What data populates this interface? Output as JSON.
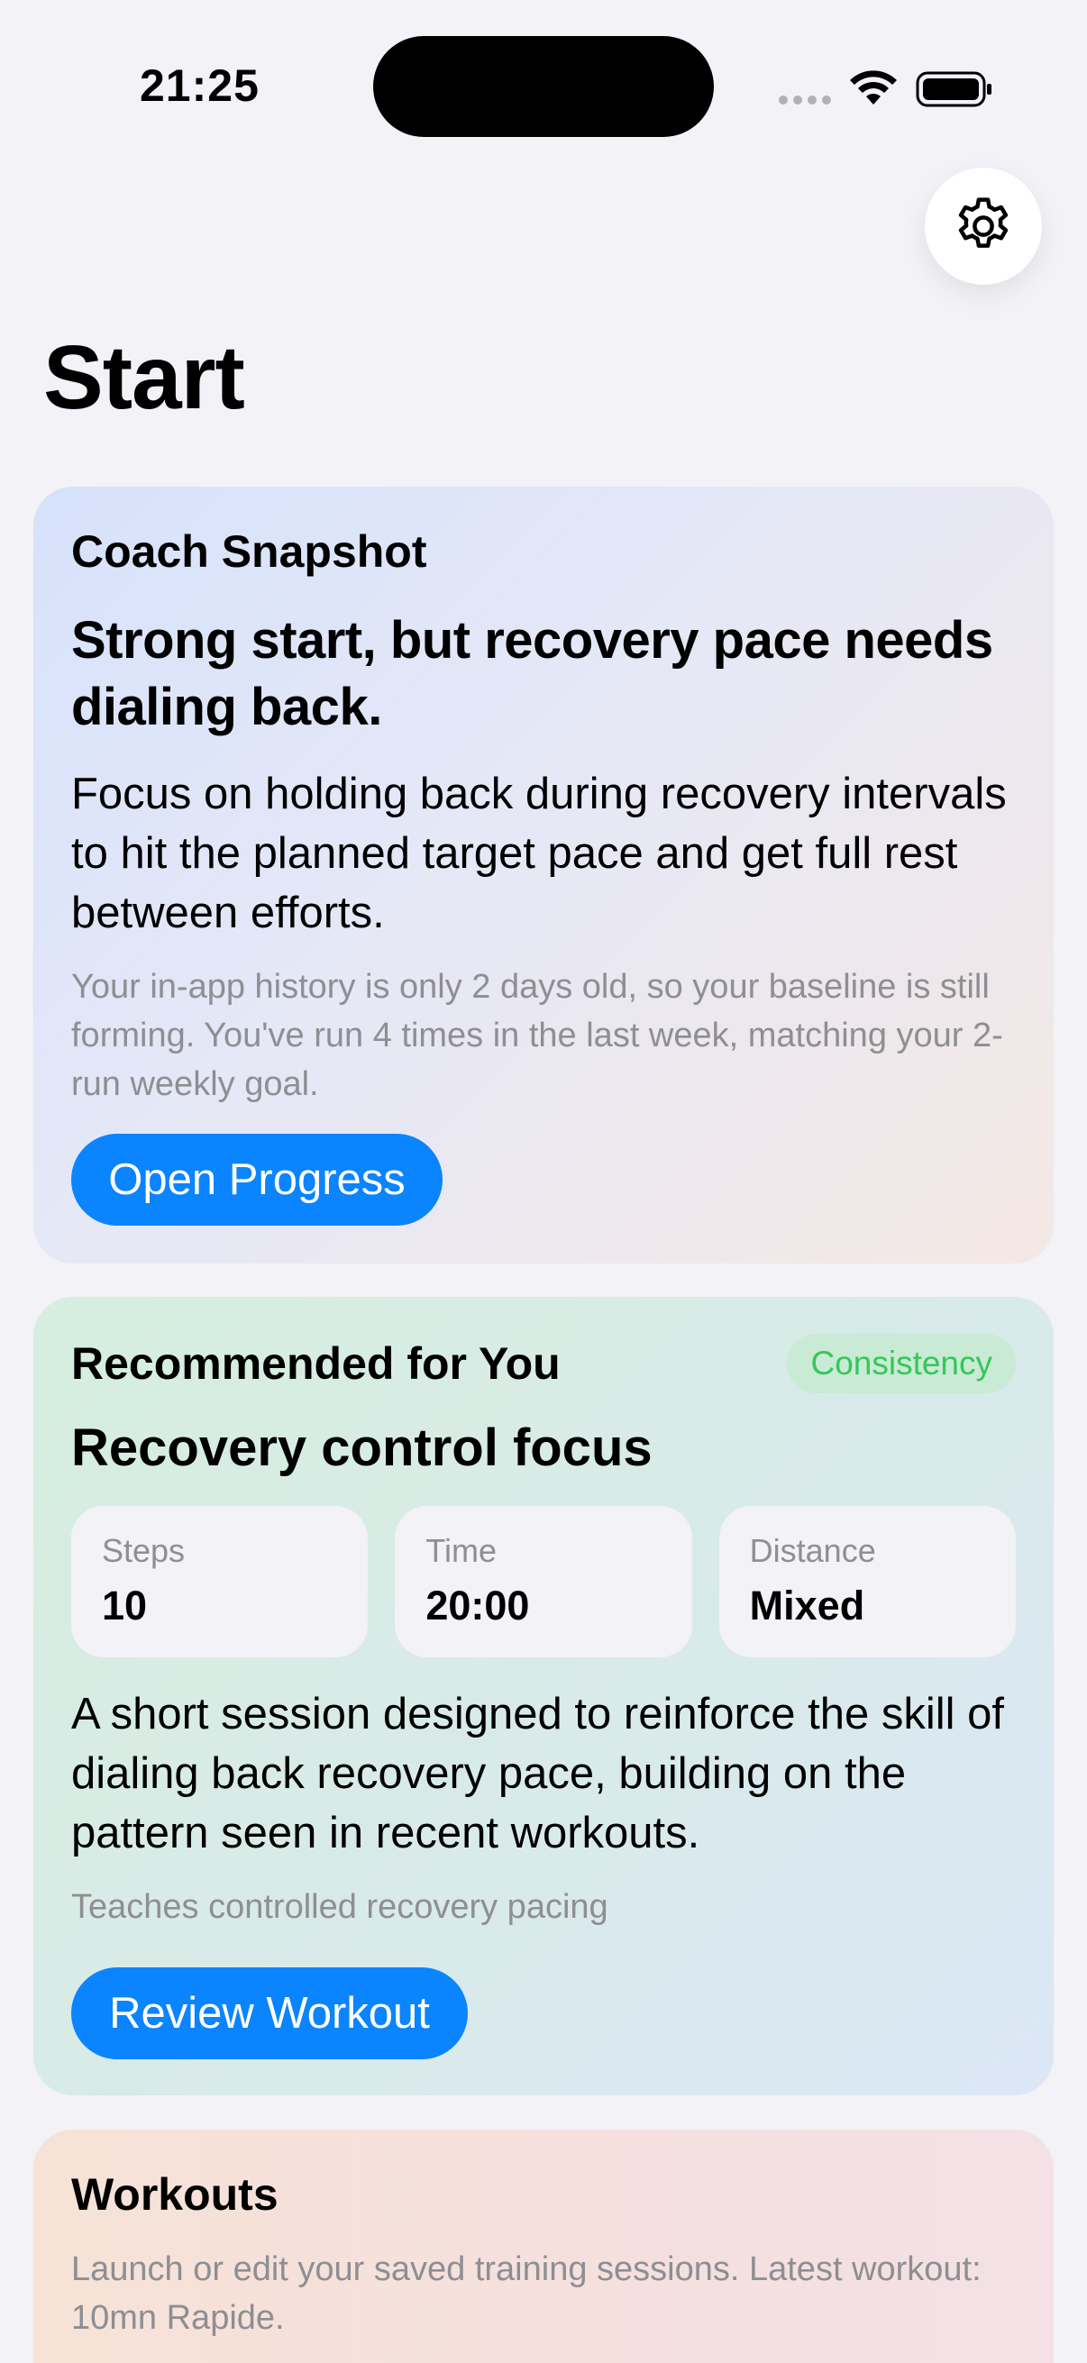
{
  "status_bar": {
    "time": "21:25"
  },
  "icons": {
    "settings": "gear-icon",
    "wifi": "wifi-icon",
    "battery": "battery-icon",
    "signal": "cellular-signal-icon"
  },
  "colors": {
    "accent": "#0a84ff",
    "badge_text": "#34c759",
    "background": "#f2f2f7"
  },
  "page": {
    "title": "Start"
  },
  "coach_card": {
    "heading": "Coach Snapshot",
    "headline": "Strong start, but recovery pace needs dialing back.",
    "body": "Focus on holding back during recovery intervals to hit the planned target pace and get full rest between efforts.",
    "note": "Your in-app history is only 2 days old, so your baseline is still forming. You've run 4 times in the last week, matching your 2-run weekly goal.",
    "button_label": "Open Progress"
  },
  "recommended_card": {
    "heading": "Recommended for You",
    "badge": "Consistency",
    "title": "Recovery control focus",
    "metrics": [
      {
        "label": "Steps",
        "value": "10"
      },
      {
        "label": "Time",
        "value": "20:00"
      },
      {
        "label": "Distance",
        "value": "Mixed"
      }
    ],
    "body": "A short session designed to reinforce the skill of dialing back recovery pace, building on the pattern seen in recent workouts.",
    "note": "Teaches controlled recovery pacing",
    "button_label": "Review Workout"
  },
  "workouts_card": {
    "heading": "Workouts",
    "description": "Launch or edit your saved training sessions. Latest workout: 10mn Rapide."
  }
}
